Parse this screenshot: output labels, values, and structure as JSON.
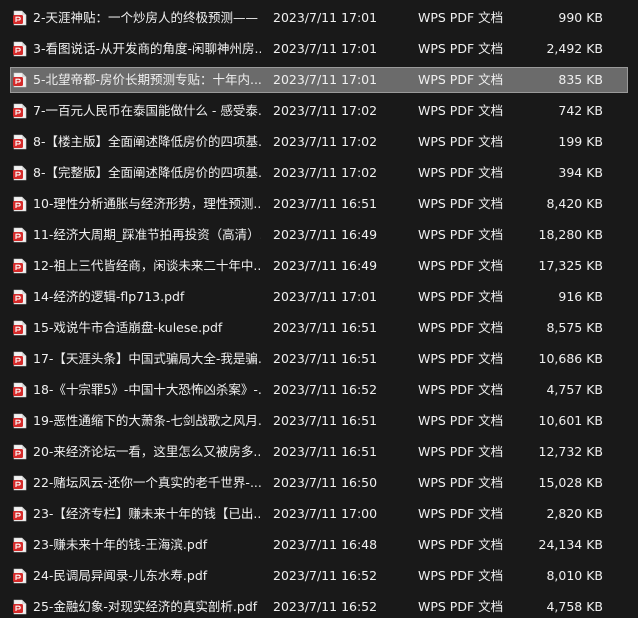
{
  "file_icon": "pdf-file-icon",
  "selected_index": 2,
  "files": [
    {
      "name": "2-天涯神贴：一个炒房人的终极预测——",
      "date": "2023/7/11 17:01",
      "type": "WPS PDF 文档",
      "size": "990 KB"
    },
    {
      "name": "3-看图说话-从开发商的角度-闲聊神州房...",
      "date": "2023/7/11 17:01",
      "type": "WPS PDF 文档",
      "size": "2,492 KB"
    },
    {
      "name": "5-北望帝都-房价长期预测专贴：十年内...",
      "date": "2023/7/11 17:01",
      "type": "WPS PDF 文档",
      "size": "835 KB"
    },
    {
      "name": "7-一百元人民币在泰国能做什么 - 感受泰...",
      "date": "2023/7/11 17:02",
      "type": "WPS PDF 文档",
      "size": "742 KB"
    },
    {
      "name": "8-【楼主版】全面阐述降低房价的四项基...",
      "date": "2023/7/11 17:02",
      "type": "WPS PDF 文档",
      "size": "199 KB"
    },
    {
      "name": "8-【完整版】全面阐述降低房价的四项基...",
      "date": "2023/7/11 17:02",
      "type": "WPS PDF 文档",
      "size": "394 KB"
    },
    {
      "name": "10-理性分析通胀与经济形势，理性预测...",
      "date": "2023/7/11 16:51",
      "type": "WPS PDF 文档",
      "size": "8,420 KB"
    },
    {
      "name": "11-经济大周期_踩准节拍再投资（高清）...",
      "date": "2023/7/11 16:49",
      "type": "WPS PDF 文档",
      "size": "18,280 KB"
    },
    {
      "name": "12-祖上三代皆经商，闲谈未来二十年中...",
      "date": "2023/7/11 16:49",
      "type": "WPS PDF 文档",
      "size": "17,325 KB"
    },
    {
      "name": "14-经济的逻辑-flp713.pdf",
      "date": "2023/7/11 17:01",
      "type": "WPS PDF 文档",
      "size": "916 KB"
    },
    {
      "name": "15-戏说牛市合适崩盘-kulese.pdf",
      "date": "2023/7/11 16:51",
      "type": "WPS PDF 文档",
      "size": "8,575 KB"
    },
    {
      "name": "17-【天涯头条】中国式骗局大全-我是骗...",
      "date": "2023/7/11 16:51",
      "type": "WPS PDF 文档",
      "size": "10,686 KB"
    },
    {
      "name": "18-《十宗罪5》-中国十大恐怖凶杀案》-...",
      "date": "2023/7/11 16:52",
      "type": "WPS PDF 文档",
      "size": "4,757 KB"
    },
    {
      "name": "19-恶性通缩下的大萧条-七剑战歌之风月...",
      "date": "2023/7/11 16:51",
      "type": "WPS PDF 文档",
      "size": "10,601 KB"
    },
    {
      "name": "20-来经济论坛一看，这里怎么又被房多...",
      "date": "2023/7/11 16:51",
      "type": "WPS PDF 文档",
      "size": "12,732 KB"
    },
    {
      "name": "22-赌坛风云-还你一个真实的老千世界-...",
      "date": "2023/7/11 16:50",
      "type": "WPS PDF 文档",
      "size": "15,028 KB"
    },
    {
      "name": "23-【经济专栏】赚未来十年的钱【已出...",
      "date": "2023/7/11 17:00",
      "type": "WPS PDF 文档",
      "size": "2,820 KB"
    },
    {
      "name": "23-赚未来十年的钱-王海滨.pdf",
      "date": "2023/7/11 16:48",
      "type": "WPS PDF 文档",
      "size": "24,134 KB"
    },
    {
      "name": "24-民调局异闻录-儿东水寿.pdf",
      "date": "2023/7/11 16:52",
      "type": "WPS PDF 文档",
      "size": "8,010 KB"
    },
    {
      "name": "25-金融幻象-对现实经济的真实剖析.pdf",
      "date": "2023/7/11 16:52",
      "type": "WPS PDF 文档",
      "size": "4,758 KB"
    }
  ]
}
